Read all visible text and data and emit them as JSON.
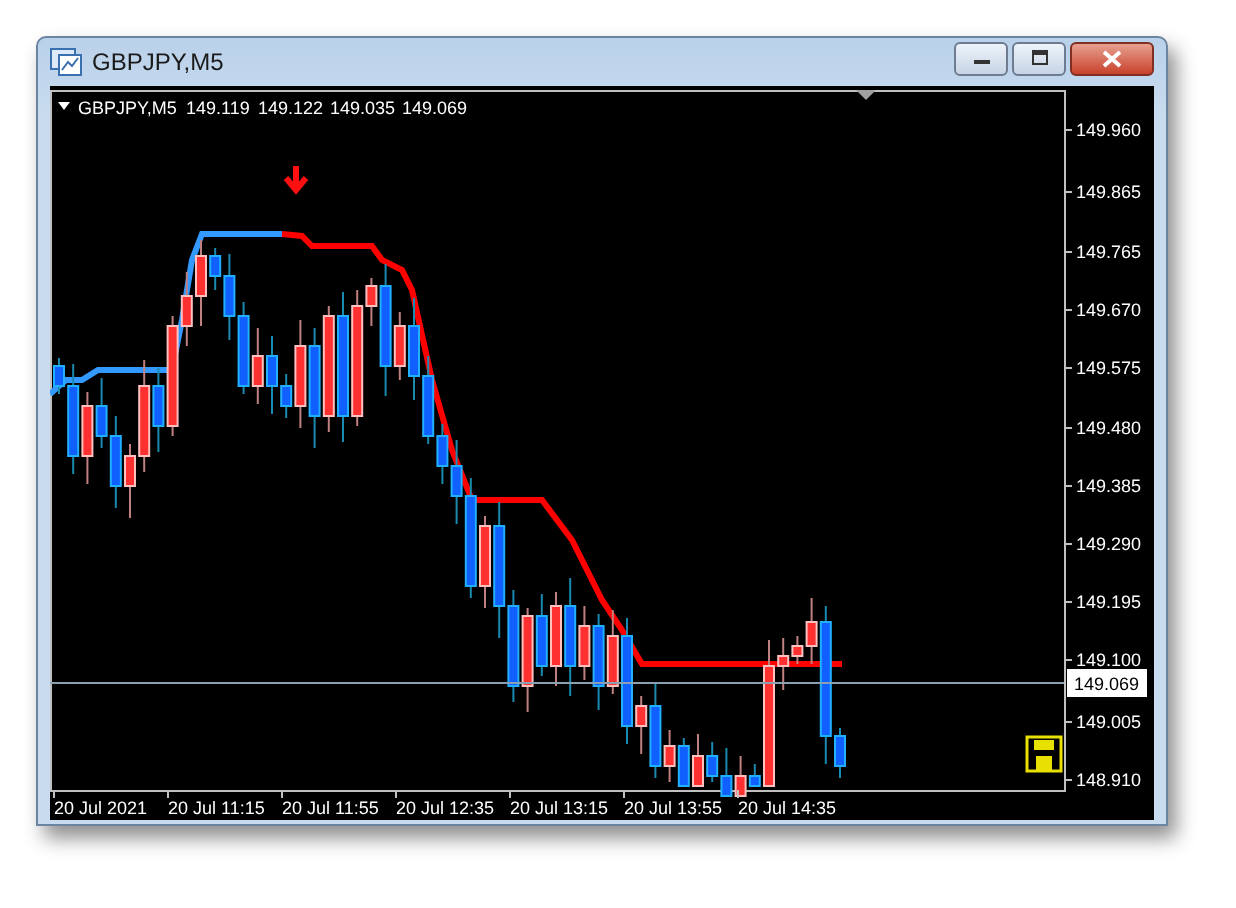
{
  "window": {
    "title": "GBPJPY,M5"
  },
  "header": {
    "symbol": "GBPJPY,M5",
    "quotes": [
      "149.119",
      "149.122",
      "149.035",
      "149.069"
    ]
  },
  "price_axis": [
    "149.960",
    "149.865",
    "149.765",
    "149.670",
    "149.575",
    "149.480",
    "149.385",
    "149.290",
    "149.195",
    "149.100",
    "149.005",
    "148.910"
  ],
  "bid_label": "149.069",
  "time_axis": [
    "20 Jul 2021",
    "20 Jul 11:15",
    "20 Jul 11:55",
    "20 Jul 12:35",
    "20 Jul 13:15",
    "20 Jul 13:55",
    "20 Jul 14:35"
  ]
}
